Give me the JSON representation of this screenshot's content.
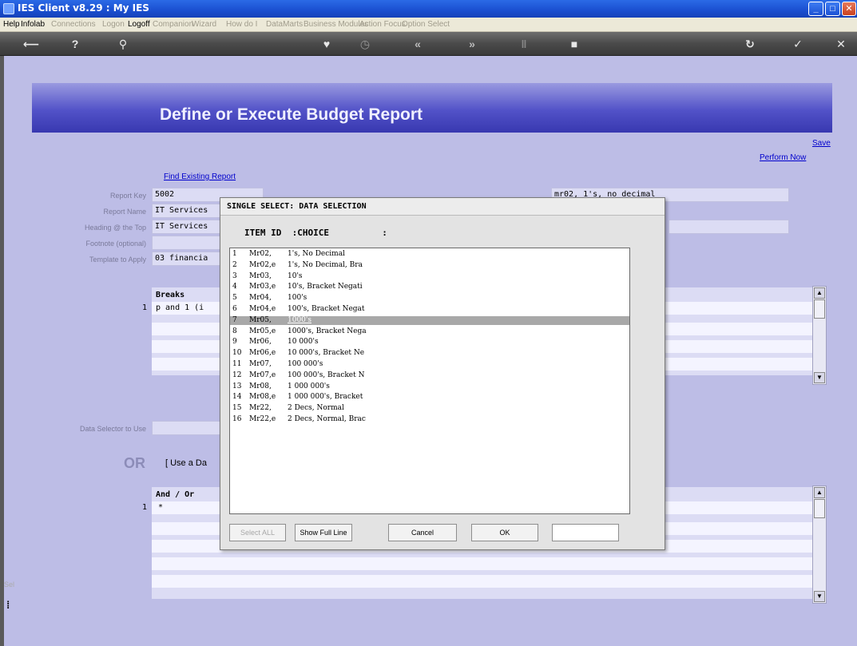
{
  "window": {
    "title": "IES Client v8.29 : My IES"
  },
  "menu": {
    "items": [
      "Help",
      "Infolab",
      "Connections",
      "Logon",
      "Logoff",
      "Companion",
      "Wizard",
      "How do I",
      "DataMarts",
      "Business Modules",
      "Action Focus",
      "Option Select"
    ],
    "active": [
      true,
      true,
      false,
      false,
      true,
      false,
      false,
      false,
      false,
      false,
      false,
      false
    ]
  },
  "toolbar": {
    "icons": [
      "back-arrow-icon",
      "help-icon",
      "search-icon",
      "heart-icon",
      "clock-icon",
      "rewind-icon",
      "forward-icon",
      "pause-icon",
      "stop-icon",
      "refresh-icon",
      "check-icon",
      "close-icon"
    ]
  },
  "page": {
    "title": "Define or Execute Budget Report",
    "save_link": "Save",
    "perform_link": "Perform Now",
    "find_link": "Find Existing Report",
    "labels": {
      "report_key": "Report Key",
      "report_name": "Report Name",
      "heading": "Heading @ the Top",
      "footnote": "Footnote (optional)",
      "template": "Template to Apply",
      "data_selector": "Data Selector to Use"
    },
    "values": {
      "report_key": "5002",
      "report_name": "IT Services",
      "heading": "IT Services",
      "template": "03 financia",
      "right_top_field": "mr02, 1's, no decimal"
    },
    "breaks_header": "Breaks",
    "breaks_row1_num": "1",
    "breaks_row1_val": "p and 1 (i",
    "or_label": "OR",
    "use_label": "[ Use a Da",
    "andor_header": "And / Or",
    "andor_row1_num": "1",
    "andor_row1_val": "*",
    "side_text": "Sel"
  },
  "dialog": {
    "title": "SINGLE SELECT: DATA SELECTION",
    "col_item": "ITEM ID",
    "col_choice": ":CHOICE",
    "col_colon": ":",
    "selected_index": 6,
    "items": [
      {
        "n": "1",
        "id": "Mr02,",
        "choice": "1's, No Decimal"
      },
      {
        "n": "2",
        "id": "Mr02,e",
        "choice": "1's, No Decimal, Bra"
      },
      {
        "n": "3",
        "id": "Mr03,",
        "choice": "10's"
      },
      {
        "n": "4",
        "id": "Mr03,e",
        "choice": "10's, Bracket Negati"
      },
      {
        "n": "5",
        "id": "Mr04,",
        "choice": "100's"
      },
      {
        "n": "6",
        "id": "Mr04,e",
        "choice": "100's, Bracket Negat"
      },
      {
        "n": "7",
        "id": "Mr05,",
        "choice": "1000's"
      },
      {
        "n": "8",
        "id": "Mr05,e",
        "choice": "1000's, Bracket Nega"
      },
      {
        "n": "9",
        "id": "Mr06,",
        "choice": "10 000's"
      },
      {
        "n": "10",
        "id": "Mr06,e",
        "choice": "10 000's, Bracket Ne"
      },
      {
        "n": "11",
        "id": "Mr07,",
        "choice": "100 000's"
      },
      {
        "n": "12",
        "id": "Mr07,e",
        "choice": "100 000's, Bracket N"
      },
      {
        "n": "13",
        "id": "Mr08,",
        "choice": "1 000 000's"
      },
      {
        "n": "14",
        "id": "Mr08,e",
        "choice": "1 000 000's, Bracket"
      },
      {
        "n": "15",
        "id": "Mr22,",
        "choice": "2 Decs, Normal"
      },
      {
        "n": "16",
        "id": "Mr22,e",
        "choice": "2 Decs, Normal, Brac"
      }
    ],
    "buttons": {
      "select_all": "Select ALL",
      "show_full": "Show Full Line",
      "cancel": "Cancel",
      "ok": "OK"
    }
  }
}
